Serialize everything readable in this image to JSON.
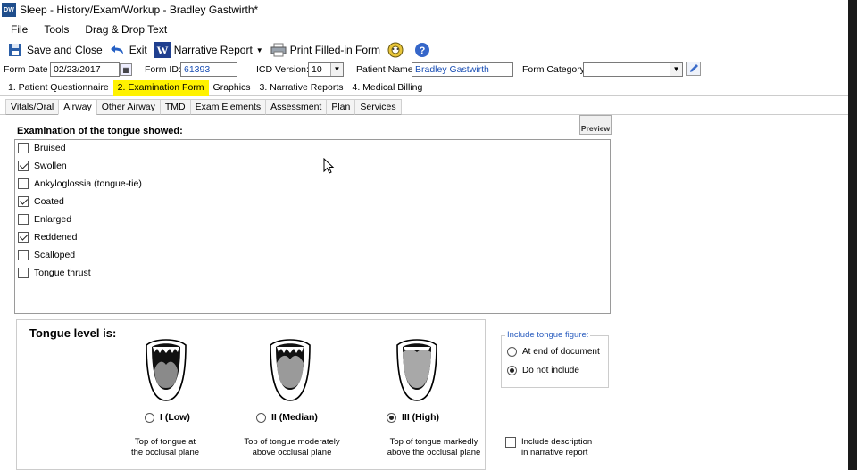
{
  "window": {
    "title": "Sleep - History/Exam/Workup - Bradley Gastwirth*",
    "logo": "DW"
  },
  "menu": [
    "File",
    "Tools",
    "Drag & Drop Text"
  ],
  "toolbar": {
    "save_close": "Save and Close",
    "exit": "Exit",
    "narrative": "Narrative Report",
    "print": "Print Filled-in Form"
  },
  "fields": {
    "form_date_label": "Form Date",
    "form_date": "02/23/2017",
    "form_id_label": "Form ID:",
    "form_id": "61393",
    "icd_label": "ICD Version:",
    "icd_value": "10",
    "patient_label": "Patient Name",
    "patient_name": "Bradley Gastwirth",
    "category_label": "Form Category:",
    "category_value": ""
  },
  "main_tabs": [
    "1. Patient Questionnaire",
    "2. Examination Form",
    "Graphics",
    "3. Narrative Reports",
    "4. Medical Billing"
  ],
  "sub_tabs": [
    "Vitals/Oral",
    "Airway",
    "Other Airway",
    "TMD",
    "Exam Elements",
    "Assessment",
    "Plan",
    "Services"
  ],
  "preview_label": "Preview",
  "exam": {
    "heading": "Examination of the tongue showed:",
    "items": [
      {
        "label": "Bruised",
        "checked": false
      },
      {
        "label": "Swollen",
        "checked": true
      },
      {
        "label": "Ankyloglossia (tongue-tie)",
        "checked": false
      },
      {
        "label": "Coated",
        "checked": true
      },
      {
        "label": "Enlarged",
        "checked": false
      },
      {
        "label": "Reddened",
        "checked": true
      },
      {
        "label": "Scalloped",
        "checked": false
      },
      {
        "label": "Tongue thrust",
        "checked": false
      }
    ]
  },
  "level": {
    "heading": "Tongue level is:",
    "options": [
      {
        "label": "I (Low)",
        "desc1": "Top of tongue at",
        "desc2": "the occlusal plane",
        "selected": false
      },
      {
        "label": "II (Median)",
        "desc1": "Top of tongue moderately",
        "desc2": "above occlusal plane",
        "selected": false
      },
      {
        "label": "III (High)",
        "desc1": "Top of tongue markedly",
        "desc2": "above the occlusal plane",
        "selected": true
      }
    ]
  },
  "figure": {
    "legend": "Include tongue figure:",
    "opt1": "At end of document",
    "opt2": "Do not include",
    "selected": "Do not include"
  },
  "include_desc": {
    "line1": "Include description",
    "line2": "in narrative report",
    "checked": false
  },
  "colors": {
    "active_tab": "#fff200",
    "link_blue": "#1a4fb5"
  }
}
